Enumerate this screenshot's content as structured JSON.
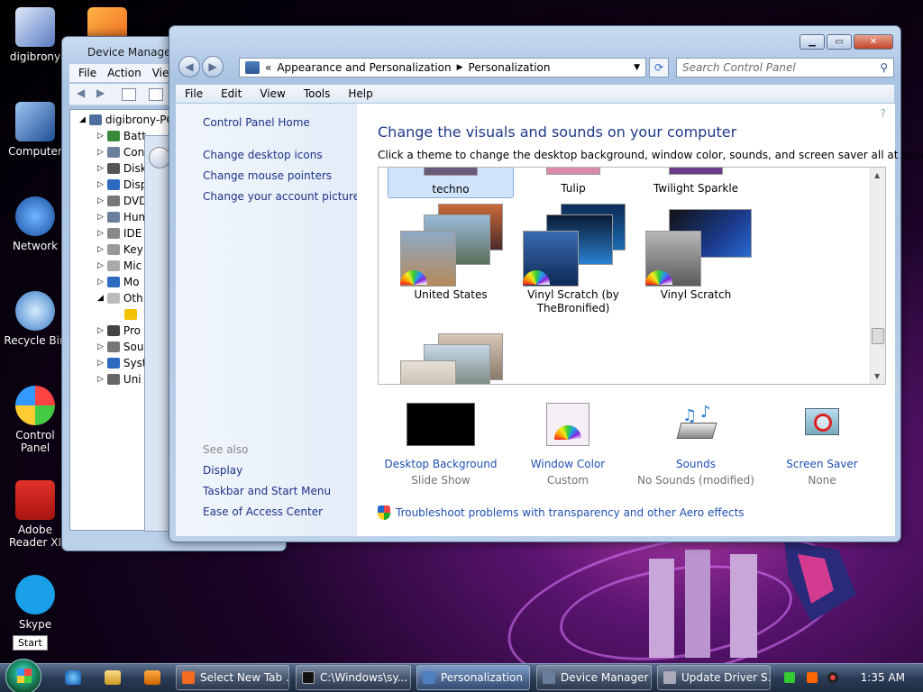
{
  "desktop": {
    "icons": [
      {
        "label": "digibrony",
        "icon": "user-folder-icon"
      },
      {
        "label": "Computer",
        "icon": "computer-icon"
      },
      {
        "label": "Network",
        "icon": "network-icon"
      },
      {
        "label": "Recycle Bin",
        "icon": "recycle-bin-icon"
      },
      {
        "label": "Control Panel",
        "icon": "control-panel-icon"
      },
      {
        "label": "Adobe Reader XI",
        "icon": "adobe-reader-icon"
      },
      {
        "label": "Skype",
        "icon": "skype-icon"
      }
    ]
  },
  "device_manager": {
    "title": "Device Manager",
    "menu": [
      "File",
      "Action",
      "View"
    ],
    "root": "digibrony-PC",
    "nodes": [
      "Batt",
      "Con",
      "Disk",
      "Disp",
      "DVD",
      "Hum",
      "IDE",
      "Key",
      "Mic",
      "Mo",
      "Oth",
      "",
      "Pro",
      "Sou",
      "Syst",
      "Uni"
    ]
  },
  "personalization": {
    "breadcrumb": {
      "prefix": "«",
      "part1": "Appearance and Personalization",
      "sep": "▶",
      "part2": "Personalization"
    },
    "search_placeholder": "Search Control Panel",
    "menu": [
      "File",
      "Edit",
      "View",
      "Tools",
      "Help"
    ],
    "left_links": [
      "Control Panel Home",
      "Change desktop icons",
      "Change mouse pointers",
      "Change your account picture"
    ],
    "see_also_label": "See also",
    "see_also_links": [
      "Display",
      "Taskbar and Start Menu",
      "Ease of Access Center"
    ],
    "heading": "Change the visuals and sounds on your computer",
    "subheading": "Click a theme to change the desktop background, window color, sounds, and screen saver all at once.",
    "themes_row1": [
      "techno",
      "Tulip",
      "Twilight Sparkle"
    ],
    "themes_row2": [
      "United States",
      "Vinyl Scratch (by TheBronified)",
      "Vinyl Scratch"
    ],
    "selected_theme": "techno",
    "settings": [
      {
        "label": "Desktop Background",
        "value": "Slide Show"
      },
      {
        "label": "Window Color",
        "value": "Custom"
      },
      {
        "label": "Sounds",
        "value": "No Sounds (modified)"
      },
      {
        "label": "Screen Saver",
        "value": "None"
      }
    ],
    "troubleshoot_link": "Troubleshoot problems with transparency and other Aero effects"
  },
  "taskbar": {
    "start_tooltip": "Start",
    "buttons": [
      {
        "label": "Select New Tab ...",
        "active": false
      },
      {
        "label": "C:\\Windows\\sy...",
        "active": false
      },
      {
        "label": "Personalization",
        "active": true
      },
      {
        "label": "Device Manager",
        "active": false
      },
      {
        "label": "Update Driver S...",
        "active": false
      }
    ],
    "clock": "1:35 AM"
  }
}
